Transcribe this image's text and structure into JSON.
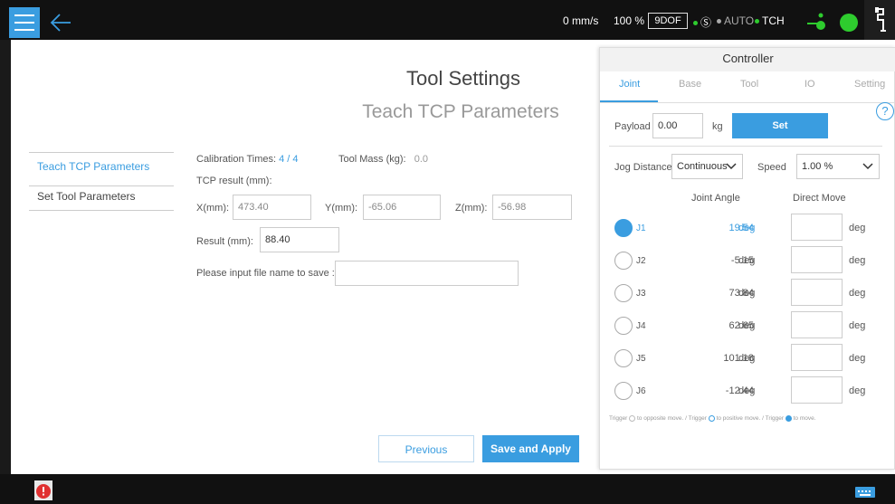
{
  "status": {
    "speed": "0 mm/s",
    "percent": "100 %",
    "dof": "9DOF",
    "s_mode": "Ⓢ",
    "auto": "AUTO",
    "tch": "TCH"
  },
  "colors": {
    "accent": "#3a9de0",
    "ok": "#2ecc2e",
    "alert": "#e03030"
  },
  "page": {
    "title": "Tool Settings",
    "subtitle": "Teach TCP Parameters"
  },
  "nav": {
    "items": [
      {
        "label": "Teach TCP Parameters"
      },
      {
        "label": "Set Tool Parameters"
      }
    ]
  },
  "form": {
    "calibration_label": "Calibration Times:",
    "calibration_current": "4",
    "calibration_sep": "/",
    "calibration_total": "4",
    "tool_mass_label": "Tool Mass (kg):",
    "tool_mass_value": "0.0",
    "tcp_result_label": "TCP result (mm):",
    "x_label": "X(mm):",
    "x_value": "473.40",
    "y_label": "Y(mm):",
    "y_value": "-65.06",
    "z_label": "Z(mm):",
    "z_value": "-56.98",
    "result_label": "Result (mm):",
    "result_value": "88.40",
    "file_label": "Please input file name to save :",
    "file_value": "",
    "previous_label": "Previous",
    "save_label": "Save and Apply"
  },
  "controller": {
    "title": "Controller",
    "tabs": [
      "Joint",
      "Base",
      "Tool",
      "IO",
      "Setting"
    ],
    "help": "?",
    "payload_label": "Payload",
    "payload_value": "0.00",
    "payload_unit": "kg",
    "set_label": "Set",
    "jog_label": "Jog Distance",
    "jog_value": "Continuous",
    "speed_label": "Speed",
    "speed_value": "1.00 %",
    "col_angle": "Joint Angle",
    "col_direct": "Direct Move",
    "joints": [
      {
        "name": "J1",
        "value": "19.54",
        "unit": "deg",
        "direct_unit": "deg",
        "selected": true
      },
      {
        "name": "J2",
        "value": "-5.15",
        "unit": "deg",
        "direct_unit": "deg",
        "selected": false
      },
      {
        "name": "J3",
        "value": "73.84",
        "unit": "deg",
        "direct_unit": "deg",
        "selected": false
      },
      {
        "name": "J4",
        "value": "62.65",
        "unit": "deg",
        "direct_unit": "deg",
        "selected": false
      },
      {
        "name": "J5",
        "value": "101.18",
        "unit": "deg",
        "direct_unit": "deg",
        "selected": false
      },
      {
        "name": "J6",
        "value": "-12.44",
        "unit": "deg",
        "direct_unit": "deg",
        "selected": false
      }
    ],
    "hint1": "Trigger",
    "hint2": "to opposite move.  /  Trigger",
    "hint3": "to positive move.  /  Trigger",
    "hint4": "to move."
  }
}
